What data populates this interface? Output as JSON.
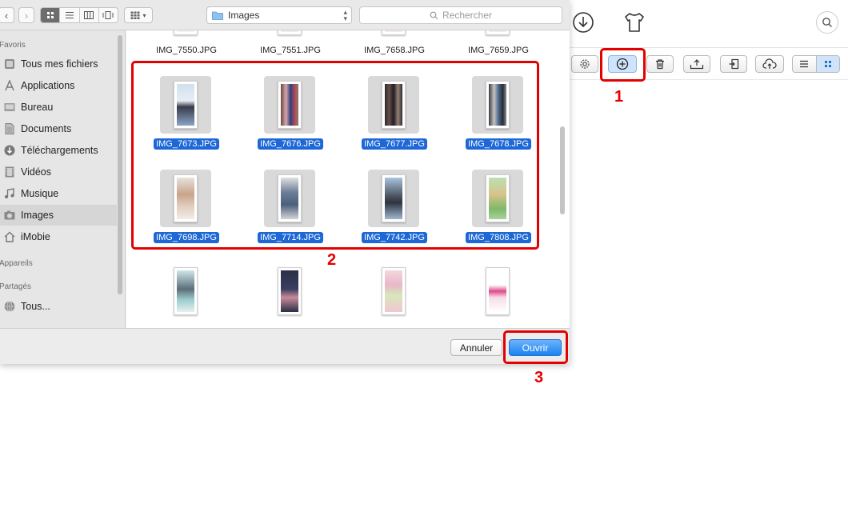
{
  "dialog": {
    "path": "Images",
    "search_placeholder": "Rechercher",
    "cancel_label": "Annuler",
    "open_label": "Ouvrir"
  },
  "sidebar": {
    "favorites_header": "Favoris",
    "favorites": [
      {
        "label": "Tous mes fichiers",
        "icon": "all-files-icon"
      },
      {
        "label": "Applications",
        "icon": "applications-icon"
      },
      {
        "label": "Bureau",
        "icon": "desktop-icon"
      },
      {
        "label": "Documents",
        "icon": "documents-icon"
      },
      {
        "label": "Téléchargements",
        "icon": "downloads-icon"
      },
      {
        "label": "Vidéos",
        "icon": "videos-icon"
      },
      {
        "label": "Musique",
        "icon": "music-icon"
      },
      {
        "label": "Images",
        "icon": "images-icon",
        "selected": true
      },
      {
        "label": "iMobie",
        "icon": "home-icon"
      }
    ],
    "devices_header": "Appareils",
    "shared_header": "Partagés",
    "shared": [
      {
        "label": "Tous...",
        "icon": "network-icon"
      }
    ]
  },
  "files": {
    "top_row": [
      "IMG_7550.JPG",
      "IMG_7551.JPG",
      "IMG_7658.JPG",
      "IMG_7659.JPG"
    ],
    "selected": [
      "IMG_7673.JPG",
      "IMG_7676.JPG",
      "IMG_7677.JPG",
      "IMG_7678.JPG",
      "IMG_7698.JPG",
      "IMG_7714.JPG",
      "IMG_7742.JPG",
      "IMG_7808.JPG"
    ]
  },
  "annotations": [
    "1",
    "2",
    "3"
  ],
  "colors": {
    "selection": "#1d68d6",
    "annotation": "#e30000",
    "primary_button": "#1a82f5"
  }
}
